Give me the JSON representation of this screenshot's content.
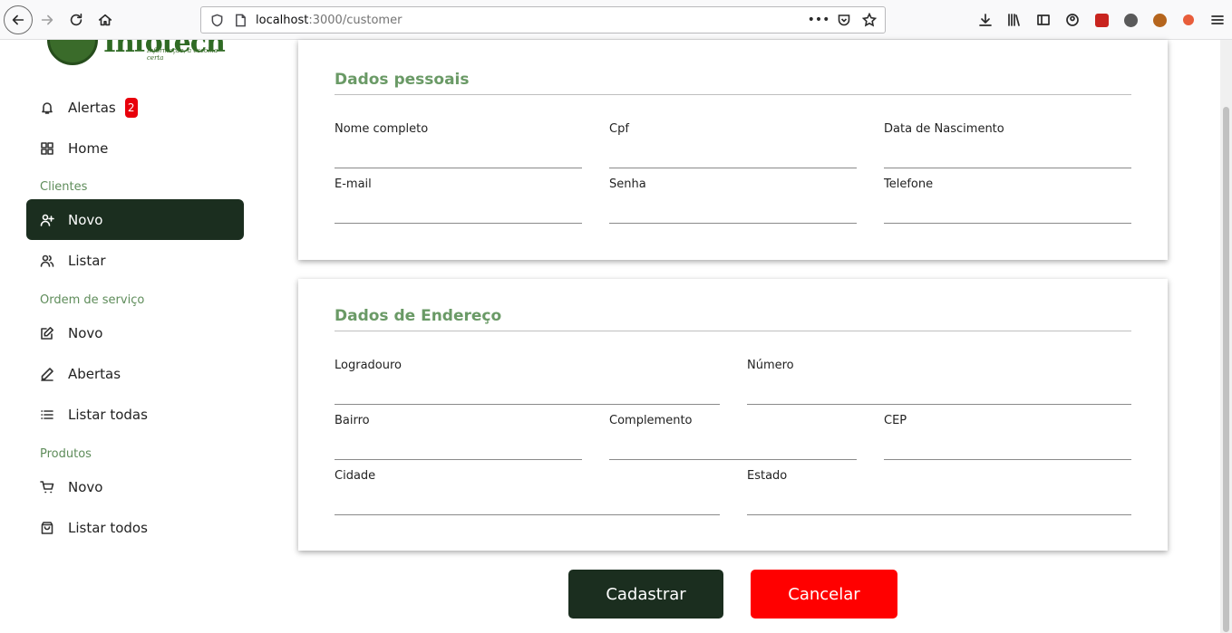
{
  "browser": {
    "url_host": "localhost",
    "url_rest": ":3000/customer",
    "more_icon_text": "•••"
  },
  "sidebar": {
    "logo_word": "Infotech",
    "logo_tagline": "Informação, a escolha certa",
    "items": [
      {
        "label": "Alertas",
        "icon": "bell-icon",
        "badge": "2"
      },
      {
        "label": "Home",
        "icon": "grid-icon"
      }
    ],
    "sections": [
      {
        "title": "Clientes",
        "items": [
          {
            "label": "Novo",
            "icon": "user-plus-icon",
            "active": true
          },
          {
            "label": "Listar",
            "icon": "users-icon"
          }
        ]
      },
      {
        "title": "Ordem de serviço",
        "items": [
          {
            "label": "Novo",
            "icon": "edit-icon"
          },
          {
            "label": "Abertas",
            "icon": "pen-icon"
          },
          {
            "label": "Listar todas",
            "icon": "list-icon"
          }
        ]
      },
      {
        "title": "Produtos",
        "items": [
          {
            "label": "Novo",
            "icon": "cart-icon"
          },
          {
            "label": "Listar todos",
            "icon": "bag-icon"
          }
        ]
      }
    ]
  },
  "personal": {
    "title": "Dados pessoais",
    "fields": [
      "Nome completo",
      "Cpf",
      "Data de Nascimento",
      "E-mail",
      "Senha",
      "Telefone"
    ]
  },
  "address": {
    "title": "Dados de Endereço",
    "fields": [
      "Logradouro",
      "Número",
      "Bairro",
      "Complemento",
      "CEP",
      "Cidade",
      "Estado"
    ]
  },
  "actions": {
    "submit_label": "Cadastrar",
    "cancel_label": "Cancelar"
  },
  "colors": {
    "sidebar_active": "#1b2e1f",
    "section_title": "#6a9a66",
    "cancel": "#ff0000",
    "badge": "#e8000b"
  }
}
